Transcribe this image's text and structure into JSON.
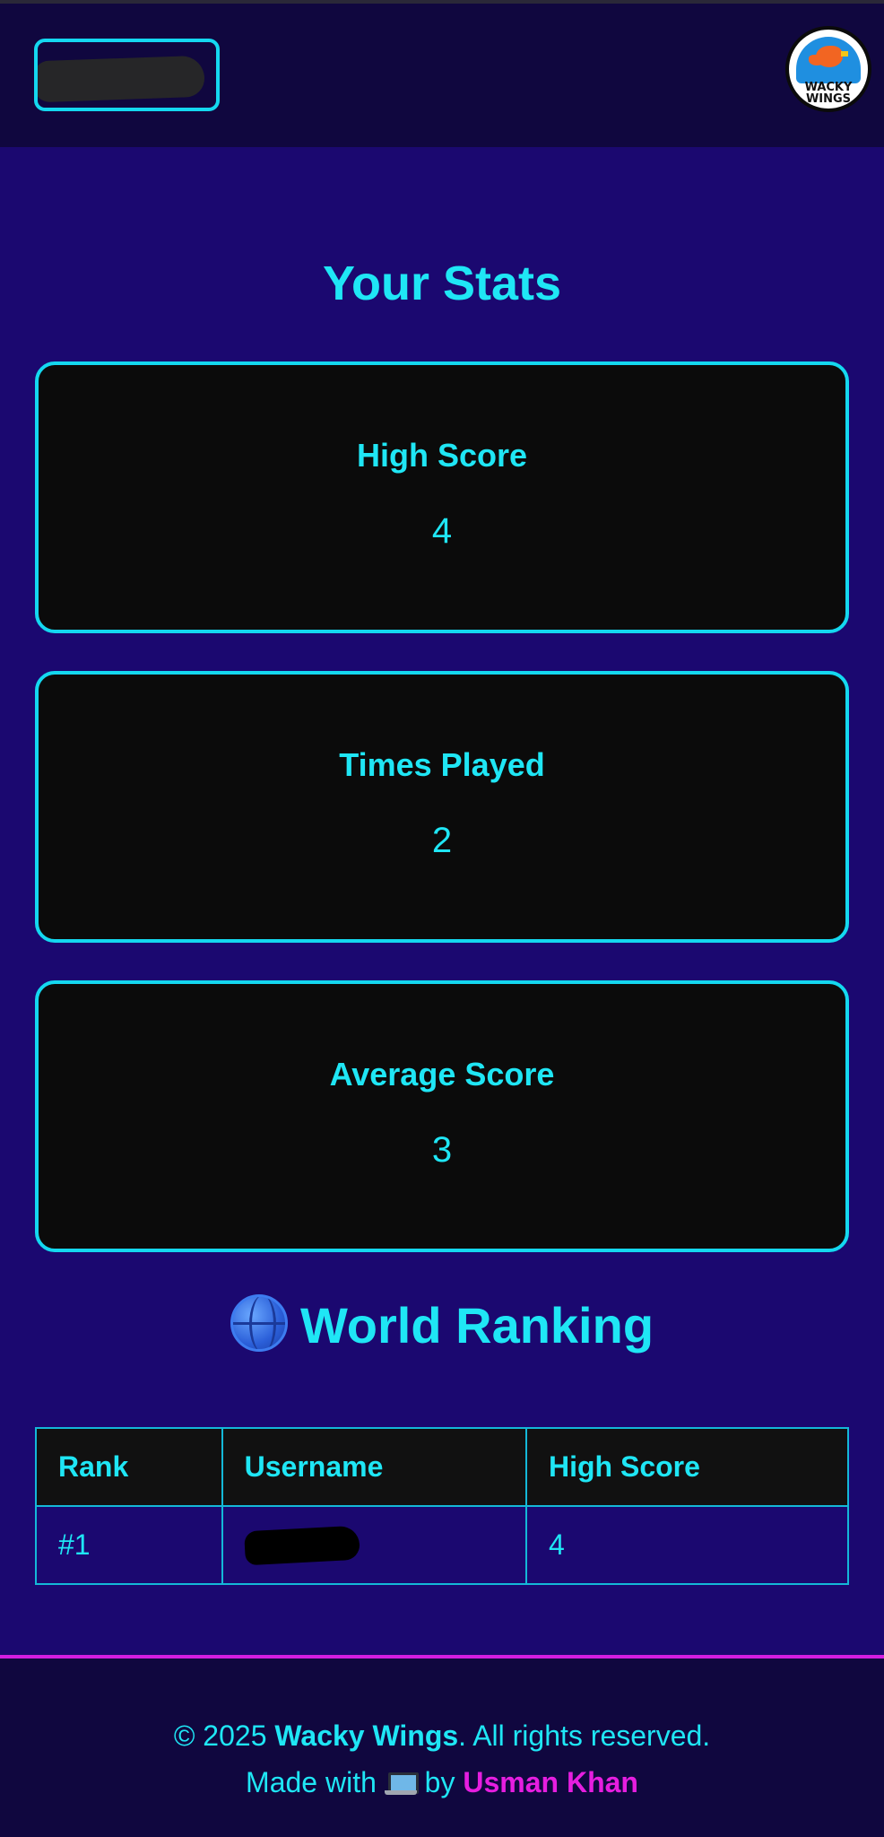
{
  "header": {
    "logo_text": "WACKY WINGS"
  },
  "stats": {
    "title": "Your Stats",
    "cards": [
      {
        "label": "High Score",
        "value": "4"
      },
      {
        "label": "Times Played",
        "value": "2"
      },
      {
        "label": "Average Score",
        "value": "3"
      }
    ]
  },
  "ranking": {
    "title": "World Ranking",
    "columns": [
      "Rank",
      "Username",
      "High Score"
    ],
    "rows": [
      {
        "rank": "#1",
        "username": "",
        "high_score": "4"
      }
    ]
  },
  "footer": {
    "copyright_prefix": "© 2025 ",
    "brand": "Wacky Wings",
    "copyright_suffix": ". All rights reserved.",
    "made_with": "Made with",
    "by": "by",
    "author": "Usman Khan"
  },
  "colors": {
    "background": "#1b0870",
    "header_bg": "#10073f",
    "accent_cyan": "#1fe6f5",
    "card_bg": "#0b0b0b",
    "author_magenta": "#e61ee0"
  },
  "icons": {
    "ranking": "globe-icon",
    "footer": "laptop-icon"
  }
}
